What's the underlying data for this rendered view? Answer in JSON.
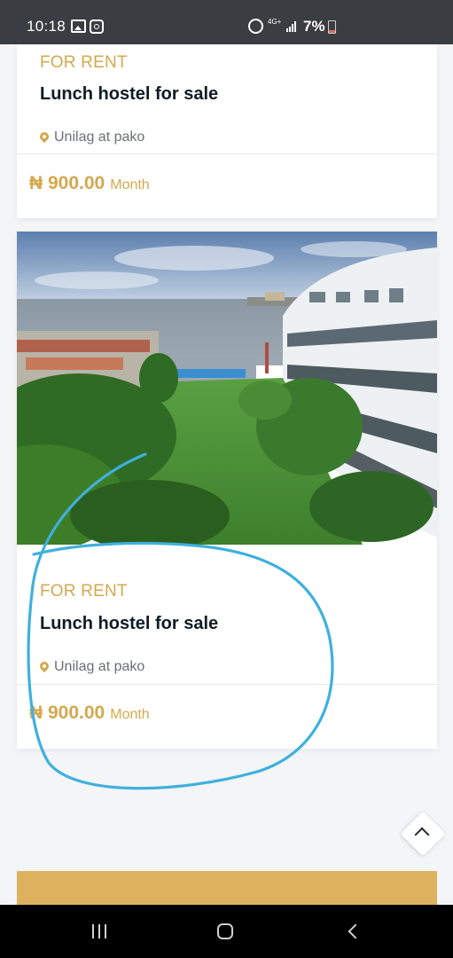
{
  "status_bar": {
    "time": "10:18",
    "network": "4G+",
    "battery": "7%",
    "icons": [
      "gallery-icon",
      "instagram-icon",
      "alarm-icon",
      "signal-icon",
      "battery-icon"
    ]
  },
  "listings": [
    {
      "tag": "FOR RENT",
      "title": "Lunch hostel for sale",
      "location": "Unilag at pako",
      "price": "₦ 900.00",
      "period": "Month"
    },
    {
      "tag": "FOR RENT",
      "title": "Lunch hostel for sale",
      "location": "Unilag at pako",
      "price": "₦ 900.00",
      "period": "Month"
    }
  ],
  "colors": {
    "accent": "#d4a84e",
    "title": "#0f1c26",
    "annotation": "#3fb0de",
    "status_bar": "#3a3d42",
    "footer": "#ddb15e"
  },
  "icons": {
    "location": "pin-icon",
    "scroll_top": "chevron-up-icon",
    "nav": [
      "recents-icon",
      "home-icon",
      "back-icon"
    ]
  }
}
